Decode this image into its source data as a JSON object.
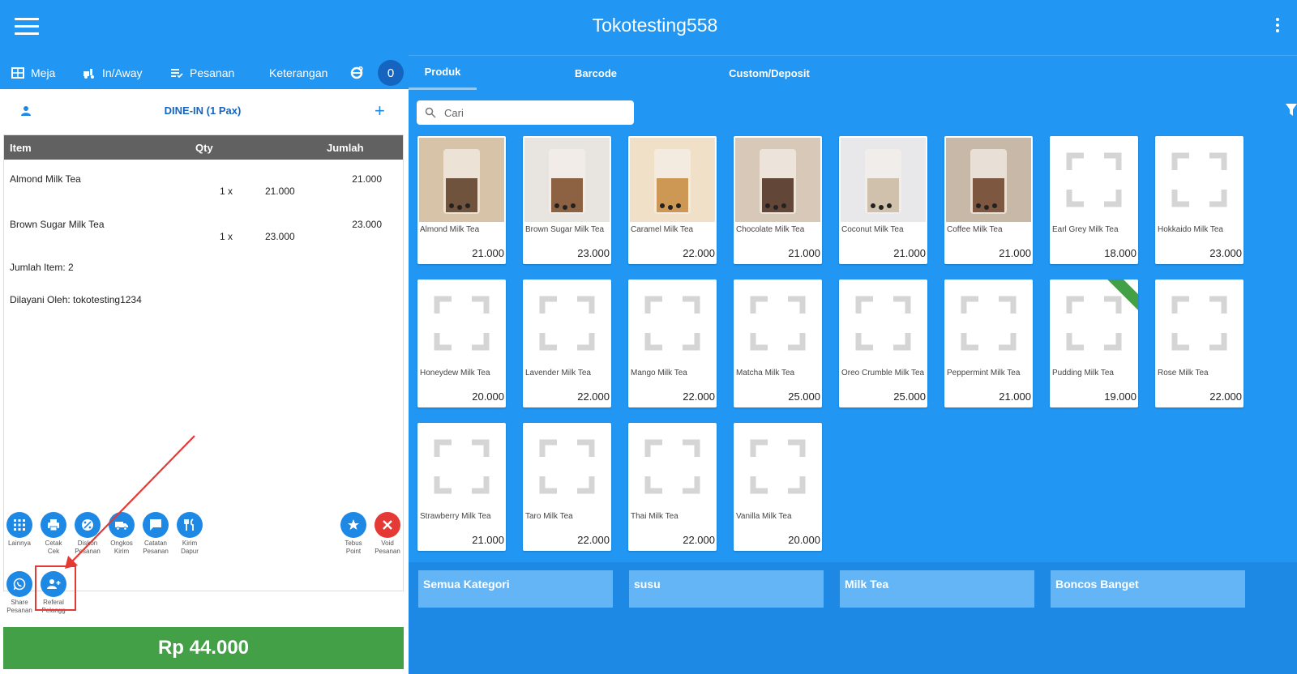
{
  "header": {
    "title": "Tokotesting558"
  },
  "left_nav": {
    "items": [
      {
        "label": "Meja",
        "icon": "table-grid-icon"
      },
      {
        "label": "In/Away",
        "icon": "bike-icon"
      },
      {
        "label": "Pesanan",
        "icon": "list-check-icon"
      },
      {
        "label": "Keterangan",
        "icon": ""
      },
      {
        "label": "",
        "icon": "internet-explorer-icon"
      }
    ],
    "count": "0"
  },
  "tabs": [
    {
      "label": "Produk",
      "active": true
    },
    {
      "label": "Barcode",
      "active": false
    },
    {
      "label": "Custom/Deposit",
      "active": false
    }
  ],
  "order": {
    "mode": "DINE-IN (1 Pax)",
    "columns": {
      "item": "Item",
      "qty": "Qty",
      "amount": "Jumlah"
    },
    "rows": [
      {
        "name": "Almond Milk Tea",
        "qty": "1 x",
        "price": "21.000",
        "amount": "21.000"
      },
      {
        "name": "Brown Sugar Milk Tea",
        "qty": "1 x",
        "price": "23.000",
        "amount": "23.000"
      }
    ],
    "item_count": "Jumlah Item: 2",
    "served_by": "Dilayani Oleh: tokotesting1234"
  },
  "actions": [
    {
      "line1": "Lainnya",
      "line2": ""
    },
    {
      "line1": "Cetak",
      "line2": "Cek"
    },
    {
      "line1": "Diskon",
      "line2": "Pesanan"
    },
    {
      "line1": "Ongkos",
      "line2": "Kirim"
    },
    {
      "line1": "Catatan",
      "line2": "Pesanan"
    },
    {
      "line1": "Kirim",
      "line2": "Dapur"
    },
    {
      "line1": "Tebus",
      "line2": "Point"
    },
    {
      "line1": "Void",
      "line2": "Pesanan"
    },
    {
      "line1": "Share",
      "line2": "Pesanan"
    },
    {
      "line1": "Referal",
      "line2": "Pelangg"
    }
  ],
  "total": "Rp 44.000",
  "search": {
    "placeholder": "Cari"
  },
  "products": [
    {
      "name": "Almond Milk Tea",
      "price": "21.000",
      "photo": true
    },
    {
      "name": "Brown Sugar Milk Tea",
      "price": "23.000",
      "photo": true
    },
    {
      "name": "Caramel Milk Tea",
      "price": "22.000",
      "photo": true
    },
    {
      "name": "Chocolate Milk Tea",
      "price": "21.000",
      "photo": true
    },
    {
      "name": "Coconut Milk Tea",
      "price": "21.000",
      "photo": true
    },
    {
      "name": "Coffee Milk Tea",
      "price": "21.000",
      "photo": true
    },
    {
      "name": "Earl Grey Milk Tea",
      "price": "18.000",
      "photo": false
    },
    {
      "name": "Hokkaido Milk Tea",
      "price": "23.000",
      "photo": false
    },
    {
      "name": "Honeydew Milk Tea",
      "price": "20.000",
      "photo": false
    },
    {
      "name": "Lavender Milk Tea",
      "price": "22.000",
      "photo": false
    },
    {
      "name": "Mango Milk Tea",
      "price": "22.000",
      "photo": false
    },
    {
      "name": "Matcha Milk Tea",
      "price": "25.000",
      "photo": false
    },
    {
      "name": "Oreo Crumble Milk Tea",
      "price": "25.000",
      "photo": false
    },
    {
      "name": "Peppermint Milk Tea",
      "price": "21.000",
      "photo": false
    },
    {
      "name": "Pudding Milk Tea",
      "price": "19.000",
      "photo": false,
      "ribbon": true
    },
    {
      "name": "Rose Milk Tea",
      "price": "22.000",
      "photo": false
    },
    {
      "name": "Strawberry Milk Tea",
      "price": "21.000",
      "photo": false
    },
    {
      "name": "Taro Milk Tea",
      "price": "22.000",
      "photo": false
    },
    {
      "name": "Thai Milk Tea",
      "price": "22.000",
      "photo": false
    },
    {
      "name": "Vanilla Milk Tea",
      "price": "20.000",
      "photo": false
    }
  ],
  "categories": [
    "Semua Kategori",
    "susu",
    "Milk Tea",
    "Boncos Banget"
  ],
  "colors": {
    "primary": "#2196f3",
    "dark": "#1565c0",
    "total": "#43a047",
    "void": "#e53935"
  }
}
